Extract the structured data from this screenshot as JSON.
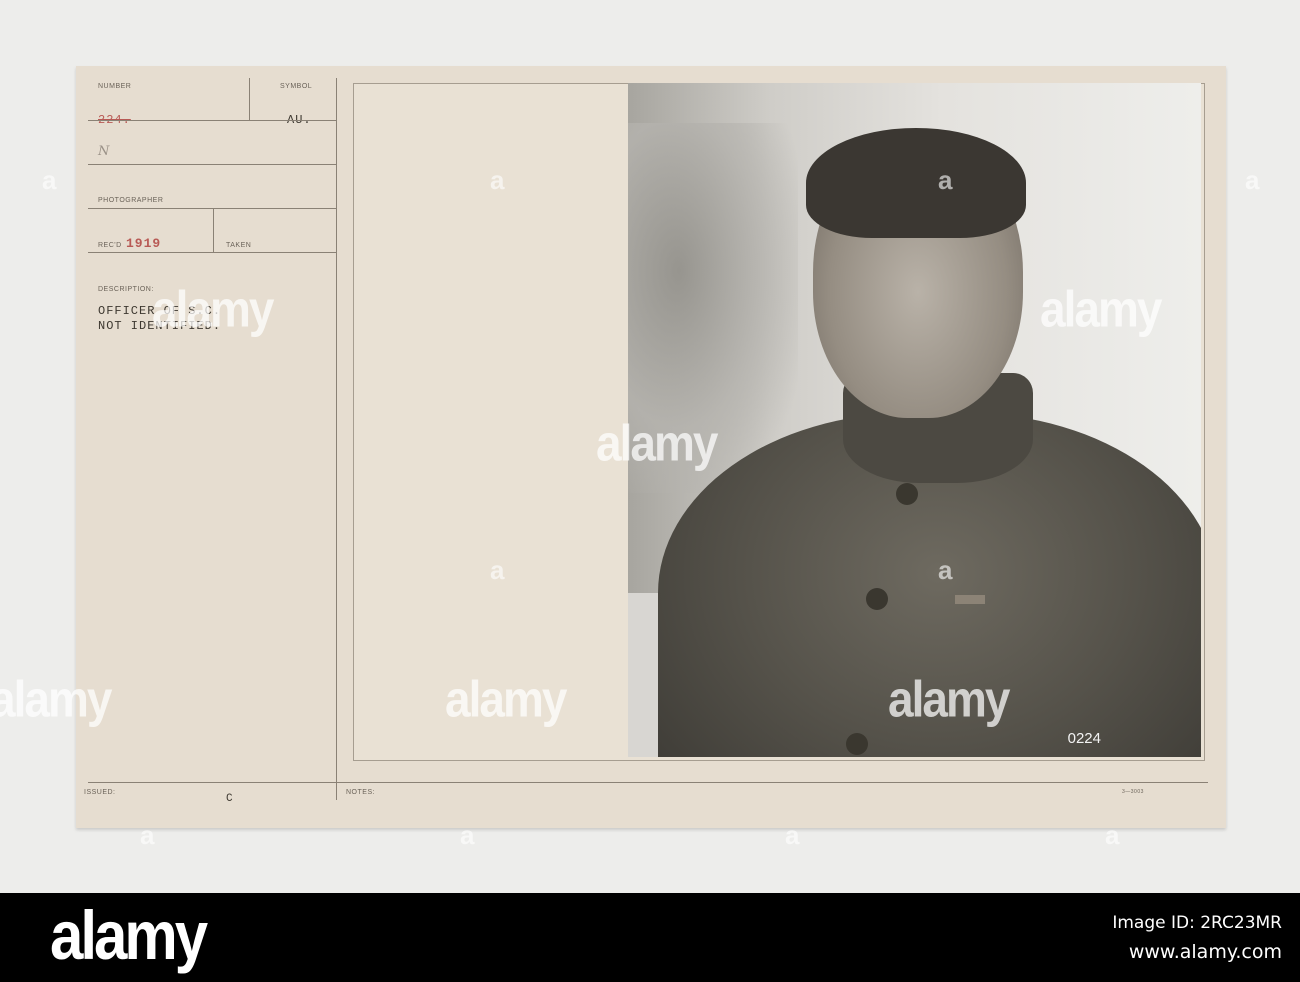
{
  "card": {
    "number_label": "NUMBER",
    "number_value": "224.",
    "symbol_label": "SYMBOL",
    "symbol_value": "AU.",
    "handwritten_mark": "N",
    "photographer_label": "PHOTOGRAPHER",
    "recd_label": "REC'D",
    "recd_value": "1919",
    "taken_label": "TAKEN",
    "description_label": "DESCRIPTION:",
    "description_lines": [
      "OFFICER OF S.C.",
      "NOT IDENTIFIED."
    ],
    "issued_label": "ISSUED:",
    "issued_value": "C",
    "notes_label": "NOTES:",
    "form_code": "3—3003",
    "photo_number": "0224"
  },
  "watermark": {
    "text": "alamy",
    "letter": "a"
  },
  "footer": {
    "logo": "alamy",
    "image_id": "Image ID: 2RC23MR",
    "url": "www.alamy.com"
  },
  "colors": {
    "card": "#e6ddd0",
    "footer": "#000000",
    "typed_red": "#b85a55"
  }
}
